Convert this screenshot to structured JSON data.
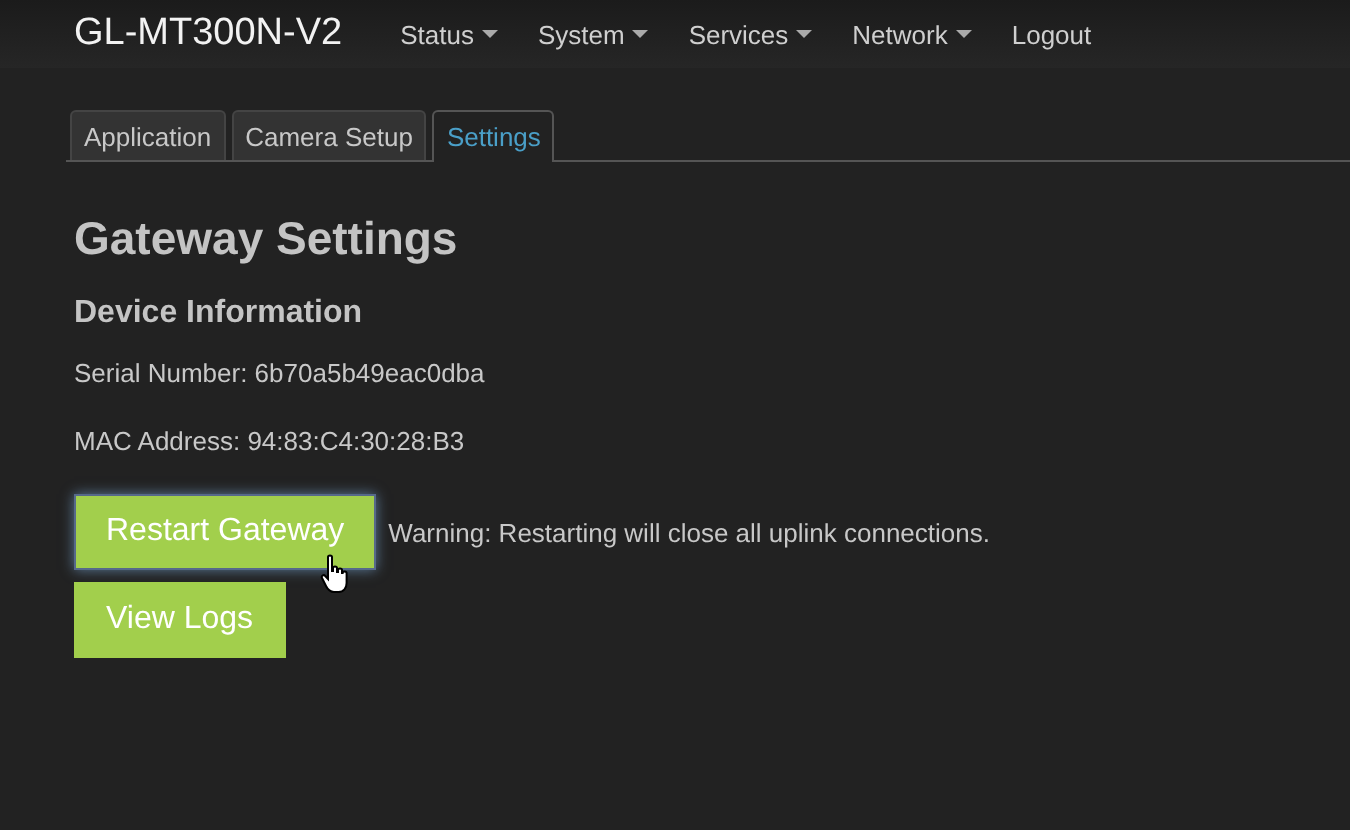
{
  "navbar": {
    "brand": "GL-MT300N-V2",
    "items": [
      {
        "label": "Status",
        "dropdown": true
      },
      {
        "label": "System",
        "dropdown": true
      },
      {
        "label": "Services",
        "dropdown": true
      },
      {
        "label": "Network",
        "dropdown": true
      },
      {
        "label": "Logout",
        "dropdown": false
      }
    ]
  },
  "tabs": [
    {
      "label": "Application",
      "selected": false
    },
    {
      "label": "Camera Setup",
      "selected": false
    },
    {
      "label": "Settings",
      "selected": true
    }
  ],
  "heading": "Gateway Settings",
  "section_title": "Device Information",
  "info": [
    "Serial Number: 6b70a5b49eac0dba",
    "MAC Address: 94:83:C4:30:28:B3"
  ],
  "actions": [
    {
      "label": "Restart Gateway",
      "focused": true,
      "note": "Warning: Restarting will close all uplink connections."
    },
    {
      "label": "View Logs",
      "focused": false
    }
  ]
}
